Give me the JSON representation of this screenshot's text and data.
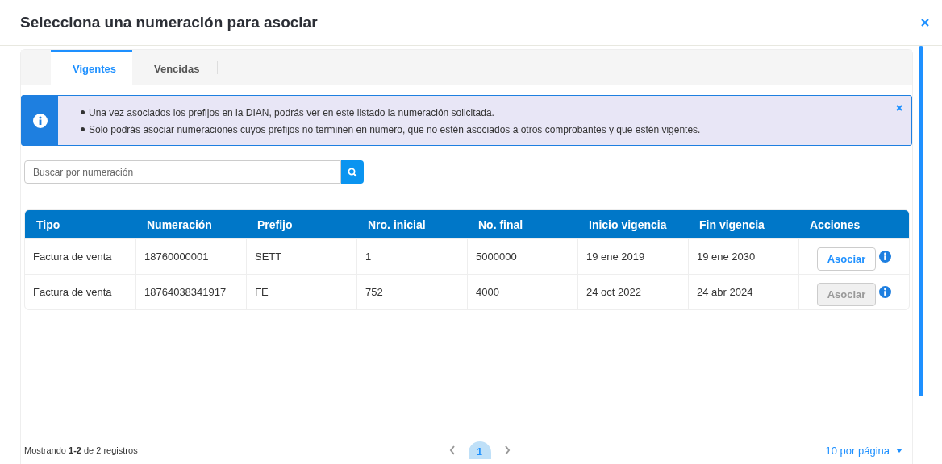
{
  "dialog": {
    "title": "Selecciona una numeración para asociar"
  },
  "tabs": [
    {
      "label": "Vigentes",
      "selected": true
    },
    {
      "label": "Vencidas",
      "selected": false
    }
  ],
  "alert": {
    "items": [
      "Una vez asociados los prefijos en la DIAN, podrás ver en este listado la numeración solicitada.",
      "Solo podrás asociar numeraciones cuyos prefijos no terminen en número, que no estén asociados a otros comprobantes y que estén vigentes."
    ]
  },
  "search": {
    "placeholder": "Buscar por numeración"
  },
  "table": {
    "columns": [
      "Tipo",
      "Numeración",
      "Prefijo",
      "Nro. inicial",
      "No. final",
      "Inicio vigencia",
      "Fin vigencia",
      "Acciones"
    ],
    "rows": [
      {
        "cells": [
          "Factura de venta",
          "18760000001",
          "SETT",
          "1",
          "5000000",
          "19 ene 2019",
          "19 ene 2030"
        ],
        "action": "Asociar",
        "disabled": false
      },
      {
        "cells": [
          "Factura de venta",
          "18764038341917",
          "FE",
          "752",
          "4000",
          "24 oct 2022",
          "24 abr 2024"
        ],
        "action": "Asociar",
        "disabled": true
      }
    ]
  },
  "footer": {
    "summary": "Mostrando **1-2** de 2 registros",
    "pages": [
      {
        "label": "1",
        "selected": true
      }
    ],
    "page_size": "10 por página"
  }
}
